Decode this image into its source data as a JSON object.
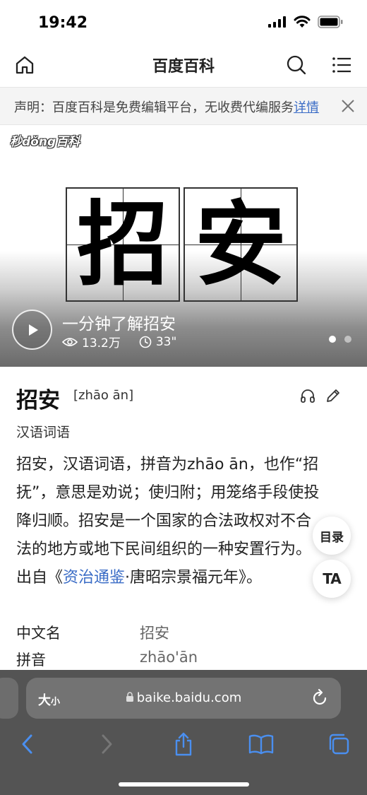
{
  "status_bar": {
    "time": "19:42"
  },
  "nav": {
    "title": "百度百科"
  },
  "notice": {
    "text": "声明：百度百科是免费编辑平台，无收费代编服务",
    "link": "详情"
  },
  "video": {
    "logo": "秒dǒng百科",
    "characters": [
      "招",
      "安"
    ],
    "title": "一分钟了解招安",
    "views": "13.2万",
    "duration": "33\""
  },
  "article": {
    "term": "招安",
    "pinyin": "[zhāo ān]",
    "category": "汉语词语",
    "para": {
      "lines": [
        "招安，汉语词语，拼音为zhāo ān，也作“招",
        "抚”，意思是劝说；使归附；用笼络手段使投",
        "降归顺。招安是一个国家的合法政权对不合",
        "法的地方或地下民间组织的一种安置行为。"
      ],
      "line5_prefix": "出自《",
      "line5_link": "资治通鉴",
      "line5_suffix": "·唐昭宗景福元年》。"
    },
    "info": [
      {
        "label": "中文名",
        "value": "招安"
      },
      {
        "label": "拼音",
        "value": "zhāo'ān"
      }
    ]
  },
  "floating": {
    "toc": "目录",
    "ta": "TA"
  },
  "browser": {
    "size_big": "大",
    "size_small": "小",
    "url": "baike.baidu.com"
  }
}
